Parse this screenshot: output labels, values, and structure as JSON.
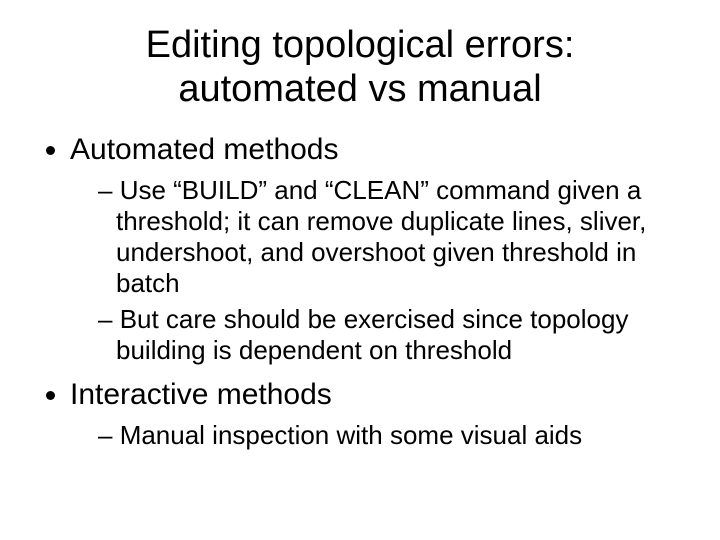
{
  "title_line1": "Editing topological errors:",
  "title_line2": "automated vs manual",
  "bullets": {
    "b1": "Automated methods",
    "b1_sub1": "Use “BUILD” and “CLEAN” command given a threshold; it can remove duplicate lines, sliver, undershoot, and overshoot given threshold in batch",
    "b1_sub2": "But care should be exercised since topology building is dependent on threshold",
    "b2": "Interactive methods",
    "b2_sub1": "Manual inspection with some visual aids"
  }
}
